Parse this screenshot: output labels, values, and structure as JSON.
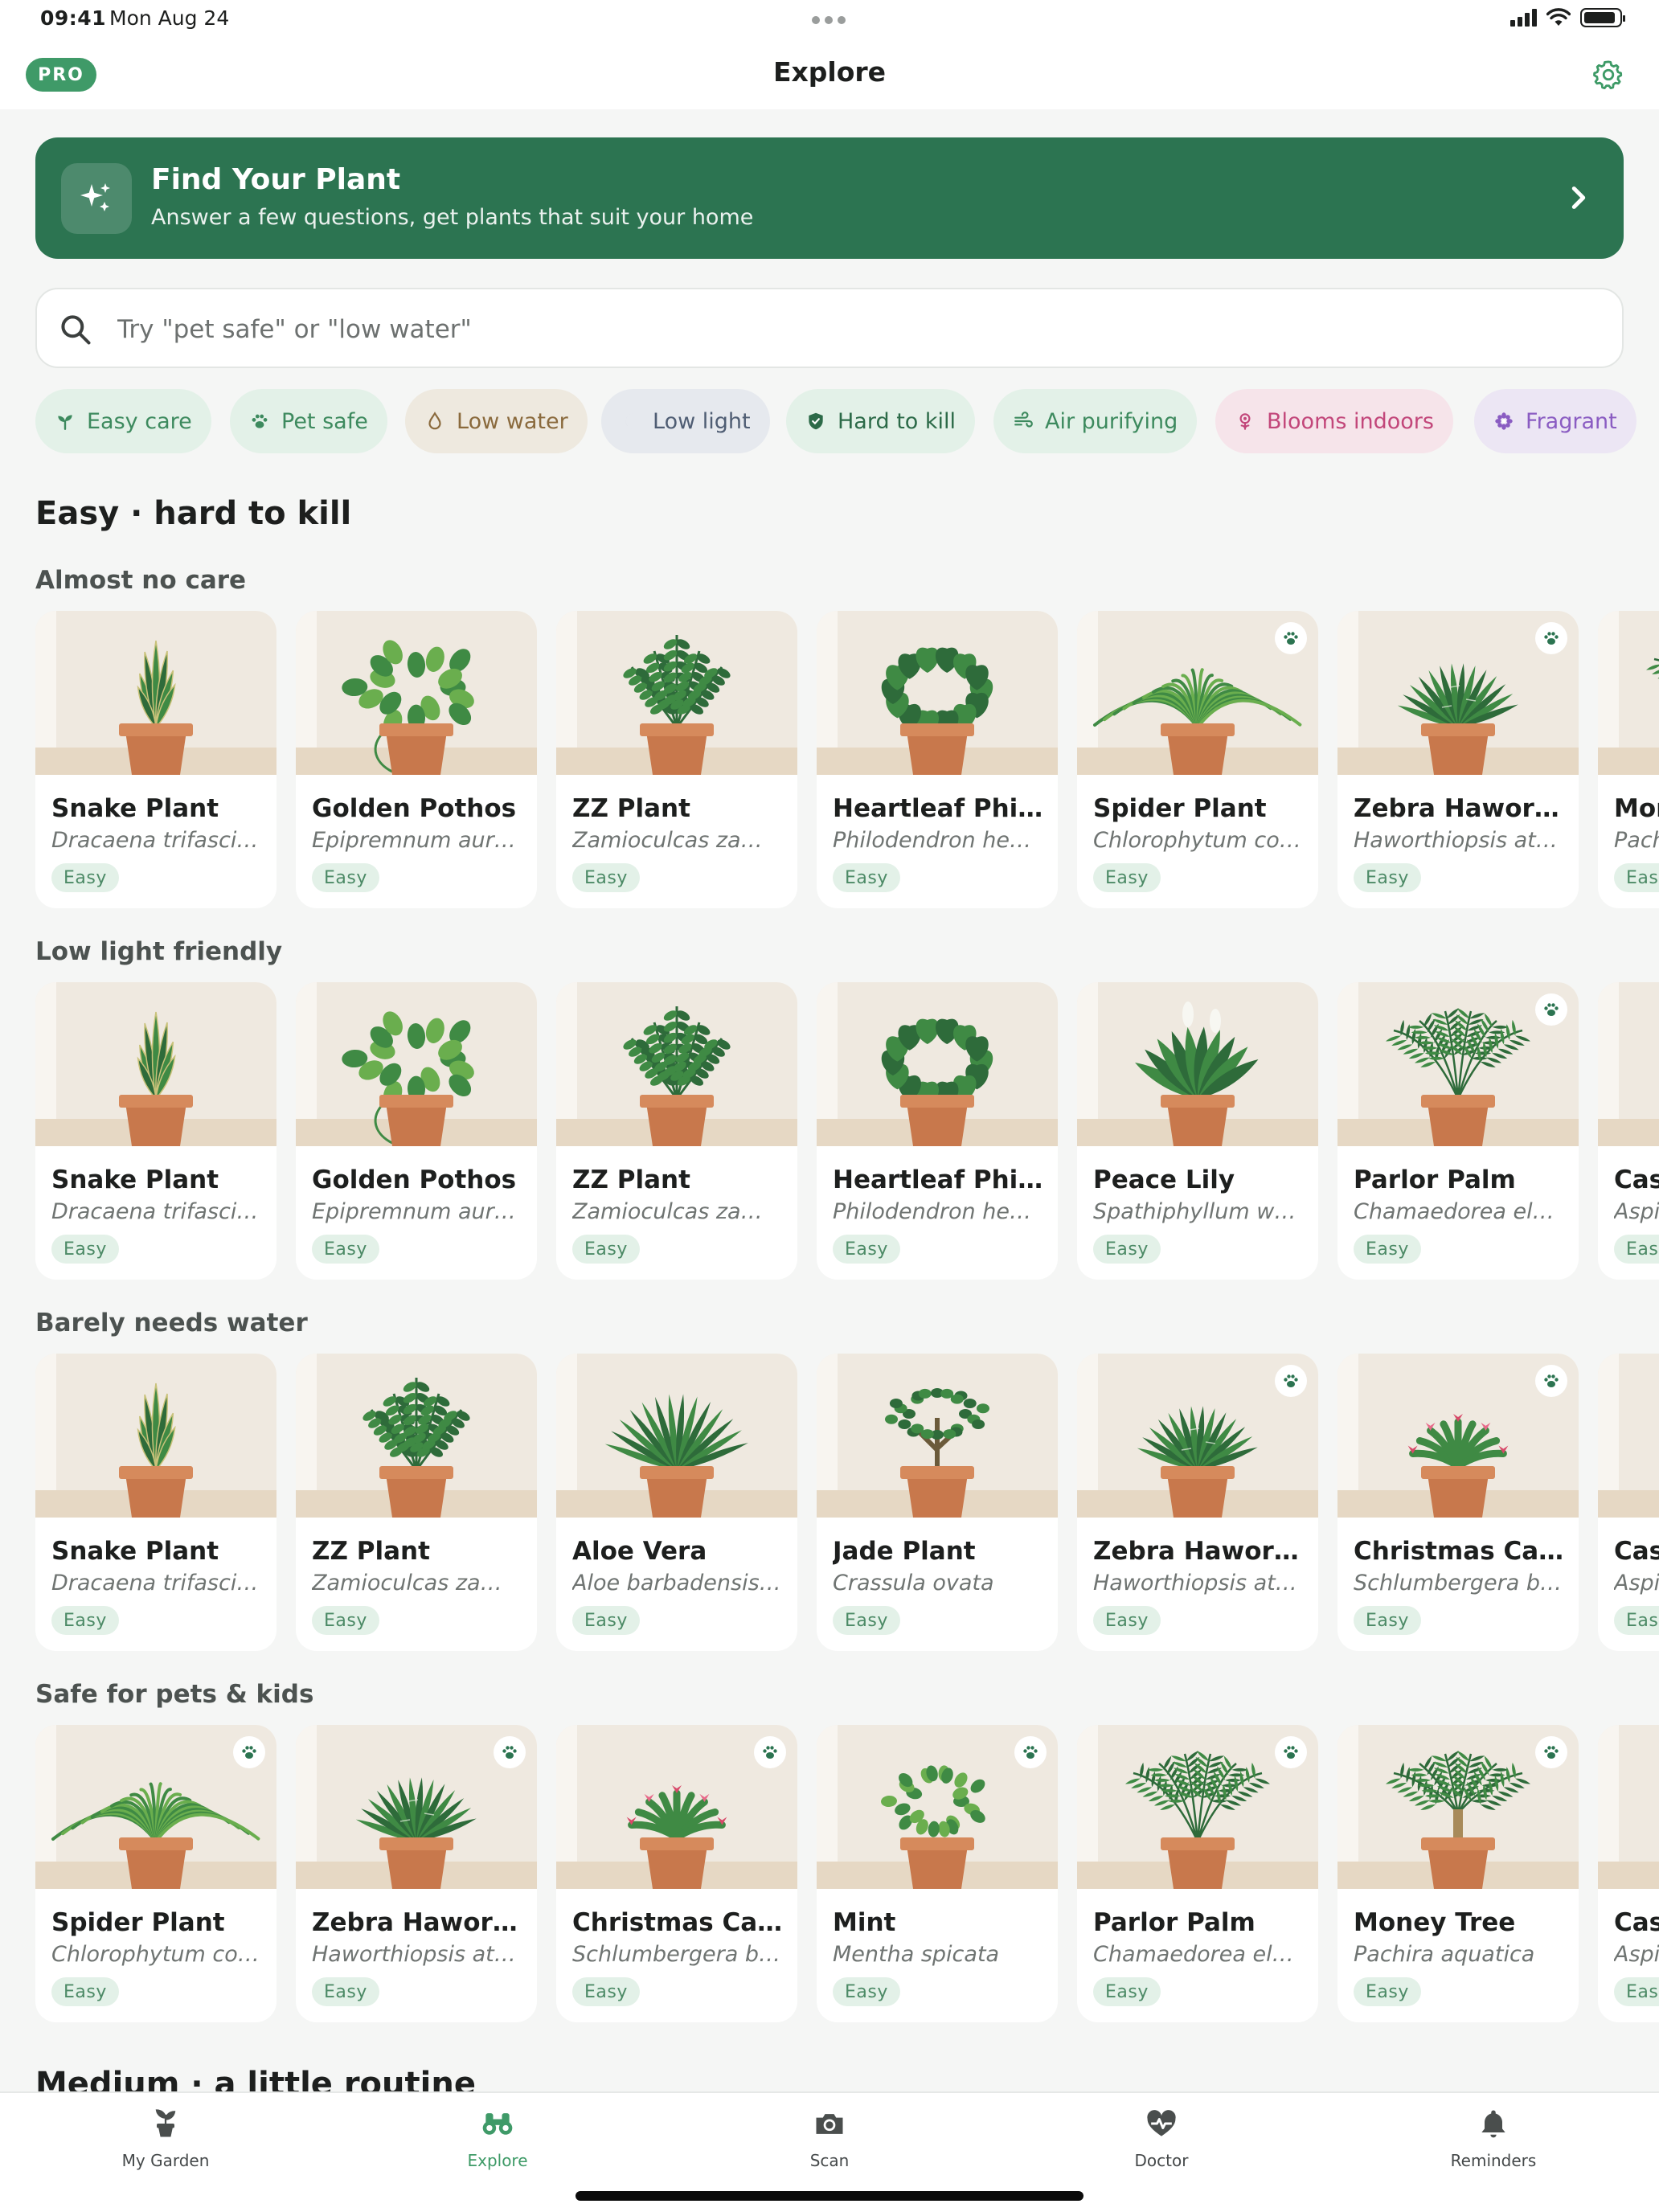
{
  "status": {
    "time": "09:41",
    "date": "Mon Aug 24",
    "battery_percent": 90
  },
  "nav": {
    "badge": "PRO",
    "title": "Explore"
  },
  "hero": {
    "title": "Find Your Plant",
    "subtitle": "Answer a few questions, get plants that suit your home"
  },
  "search": {
    "placeholder": "Try \"pet safe\" or \"low water\""
  },
  "chips": [
    {
      "label": "Easy care",
      "icon": "seedling-icon",
      "bg": "#e3f1e8",
      "fg": "#3d8a5e"
    },
    {
      "label": "Pet safe",
      "icon": "paw-icon",
      "bg": "#e3f1e8",
      "fg": "#3d8a5e"
    },
    {
      "label": "Low water",
      "icon": "water-drop-icon",
      "bg": "#eee9df",
      "fg": "#8a6a3d"
    },
    {
      "label": "Low light",
      "icon": "moon-icon",
      "bg": "#e6e9ee",
      "fg": "#4f5d73"
    },
    {
      "label": "Hard to kill",
      "icon": "shield-icon",
      "bg": "#e3f1e8",
      "fg": "#2c6a48"
    },
    {
      "label": "Air purifying",
      "icon": "wind-icon",
      "bg": "#e3f1e8",
      "fg": "#3d8a5e"
    },
    {
      "label": "Blooms indoors",
      "icon": "flower-icon",
      "bg": "#f6e4ea",
      "fg": "#c2467a"
    },
    {
      "label": "Fragrant",
      "icon": "blossom-icon",
      "bg": "#ece6f4",
      "fg": "#8a5cc2"
    }
  ],
  "section": {
    "title": "Easy · hard to kill",
    "next_title": "Medium · a little routine"
  },
  "rows": [
    {
      "title": "Almost no care",
      "cards": [
        {
          "name": "Snake Plant",
          "sci": "Dracaena trifasciata",
          "badge": "Easy",
          "pet_safe": false,
          "plant": "snake"
        },
        {
          "name": "Golden Pothos",
          "sci": "Epipremnum aureum",
          "badge": "Easy",
          "pet_safe": false,
          "plant": "pothos"
        },
        {
          "name": "ZZ Plant",
          "sci": "Zamioculcas zamiifolia",
          "badge": "Easy",
          "pet_safe": false,
          "plant": "zz"
        },
        {
          "name": "Heartleaf Philodendron",
          "sci": "Philodendron hederaceum",
          "badge": "Easy",
          "pet_safe": false,
          "plant": "heartleaf"
        },
        {
          "name": "Spider Plant",
          "sci": "Chlorophytum comosum",
          "badge": "Easy",
          "pet_safe": true,
          "plant": "spider"
        },
        {
          "name": "Zebra Haworthia",
          "sci": "Haworthiopsis attenuata",
          "badge": "Easy",
          "pet_safe": true,
          "plant": "haworthia"
        },
        {
          "name": "Money Tree",
          "sci": "Pachira aquatica",
          "badge": "Easy",
          "pet_safe": true,
          "plant": "moneytree"
        }
      ]
    },
    {
      "title": "Low light friendly",
      "cards": [
        {
          "name": "Snake Plant",
          "sci": "Dracaena trifasciata",
          "badge": "Easy",
          "pet_safe": false,
          "plant": "snake"
        },
        {
          "name": "Golden Pothos",
          "sci": "Epipremnum aureum",
          "badge": "Easy",
          "pet_safe": false,
          "plant": "pothos"
        },
        {
          "name": "ZZ Plant",
          "sci": "Zamioculcas zamiifolia",
          "badge": "Easy",
          "pet_safe": false,
          "plant": "zz"
        },
        {
          "name": "Heartleaf Philodendron",
          "sci": "Philodendron hederaceum",
          "badge": "Easy",
          "pet_safe": false,
          "plant": "heartleaf"
        },
        {
          "name": "Peace Lily",
          "sci": "Spathiphyllum wallisii",
          "badge": "Easy",
          "pet_safe": false,
          "plant": "peacelily"
        },
        {
          "name": "Parlor Palm",
          "sci": "Chamaedorea elegans",
          "badge": "Easy",
          "pet_safe": true,
          "plant": "palm"
        },
        {
          "name": "Cast Iron Plant",
          "sci": "Aspidistra elatior",
          "badge": "Easy",
          "pet_safe": true,
          "plant": "castiron"
        }
      ]
    },
    {
      "title": "Barely needs water",
      "cards": [
        {
          "name": "Snake Plant",
          "sci": "Dracaena trifasciata",
          "badge": "Easy",
          "pet_safe": false,
          "plant": "snake"
        },
        {
          "name": "ZZ Plant",
          "sci": "Zamioculcas zamiifolia",
          "badge": "Easy",
          "pet_safe": false,
          "plant": "zz"
        },
        {
          "name": "Aloe Vera",
          "sci": "Aloe barbadensis miller",
          "badge": "Easy",
          "pet_safe": false,
          "plant": "aloe"
        },
        {
          "name": "Jade Plant",
          "sci": "Crassula ovata",
          "badge": "Easy",
          "pet_safe": false,
          "plant": "jade"
        },
        {
          "name": "Zebra Haworthia",
          "sci": "Haworthiopsis attenuata",
          "badge": "Easy",
          "pet_safe": true,
          "plant": "haworthia"
        },
        {
          "name": "Christmas Cactus",
          "sci": "Schlumbergera bridgesii",
          "badge": "Easy",
          "pet_safe": true,
          "plant": "cactus"
        },
        {
          "name": "Cast Iron Plant",
          "sci": "Aspidistra elatior",
          "badge": "Easy",
          "pet_safe": true,
          "plant": "castiron"
        }
      ]
    },
    {
      "title": "Safe for pets & kids",
      "cards": [
        {
          "name": "Spider Plant",
          "sci": "Chlorophytum comosum",
          "badge": "Easy",
          "pet_safe": true,
          "plant": "spider"
        },
        {
          "name": "Zebra Haworthia",
          "sci": "Haworthiopsis attenuata",
          "badge": "Easy",
          "pet_safe": true,
          "plant": "haworthia"
        },
        {
          "name": "Christmas Cactus",
          "sci": "Schlumbergera bridgesii",
          "badge": "Easy",
          "pet_safe": true,
          "plant": "cactus"
        },
        {
          "name": "Mint",
          "sci": "Mentha spicata",
          "badge": "Easy",
          "pet_safe": true,
          "plant": "mint"
        },
        {
          "name": "Parlor Palm",
          "sci": "Chamaedorea elegans",
          "badge": "Easy",
          "pet_safe": true,
          "plant": "palm"
        },
        {
          "name": "Money Tree",
          "sci": "Pachira aquatica",
          "badge": "Easy",
          "pet_safe": true,
          "plant": "moneytree"
        },
        {
          "name": "Cast Iron Plant",
          "sci": "Aspidistra elatior",
          "badge": "Easy",
          "pet_safe": true,
          "plant": "castiron"
        }
      ]
    }
  ],
  "tabs": [
    {
      "label": "My Garden",
      "icon": "potted-plant-icon",
      "active": false
    },
    {
      "label": "Explore",
      "icon": "binoculars-icon",
      "active": true
    },
    {
      "label": "Scan",
      "icon": "camera-icon",
      "active": false
    },
    {
      "label": "Doctor",
      "icon": "heart-pulse-icon",
      "active": false
    },
    {
      "label": "Reminders",
      "icon": "bell-icon",
      "active": false
    }
  ],
  "colors": {
    "accent": "#2c7451",
    "accent_light": "#3f9a68",
    "badge_bg": "#e3f1e8",
    "page_bg": "#f5f6f5"
  }
}
